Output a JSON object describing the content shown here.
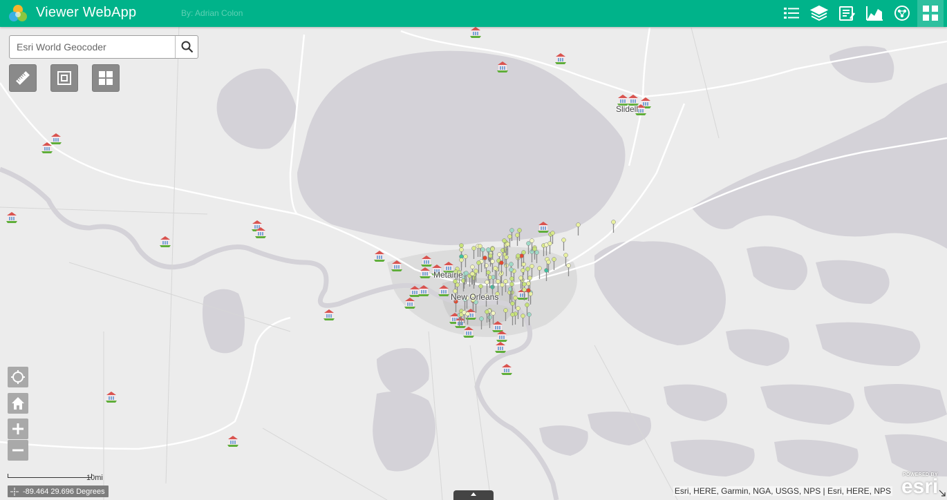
{
  "header": {
    "title": "Viewer WebApp",
    "subtitle": "By: Adrian Colon",
    "tools": [
      "legend-icon",
      "layers-icon",
      "attribute-table-icon",
      "chart-icon",
      "analysis-icon",
      "widget-grid-icon"
    ]
  },
  "search": {
    "placeholder": "Esri World Geocoder",
    "value": ""
  },
  "widgets": [
    "measurement-icon",
    "print-icon",
    "basemap-gallery-icon"
  ],
  "nav": [
    "locate-icon",
    "home-icon",
    "zoom-in-icon",
    "zoom-out-icon"
  ],
  "labels": {
    "slidell": "Slidell",
    "metairie": "Metairie",
    "new_orleans": "New Orleans"
  },
  "scalebar": {
    "label": "10mi"
  },
  "coordinates": {
    "text": "-89.464 29.696 Degrees"
  },
  "attribution": "Esri, HERE, Garmin, NGA, USGS, NPS | Esri, HERE, NPS",
  "esri_logo": {
    "powered": "POWERED BY",
    "word": "esri"
  },
  "colors": {
    "header": "#00b38a",
    "water": "#d4d2d8",
    "land": "#ececec",
    "urban": "#d9d8d8"
  }
}
